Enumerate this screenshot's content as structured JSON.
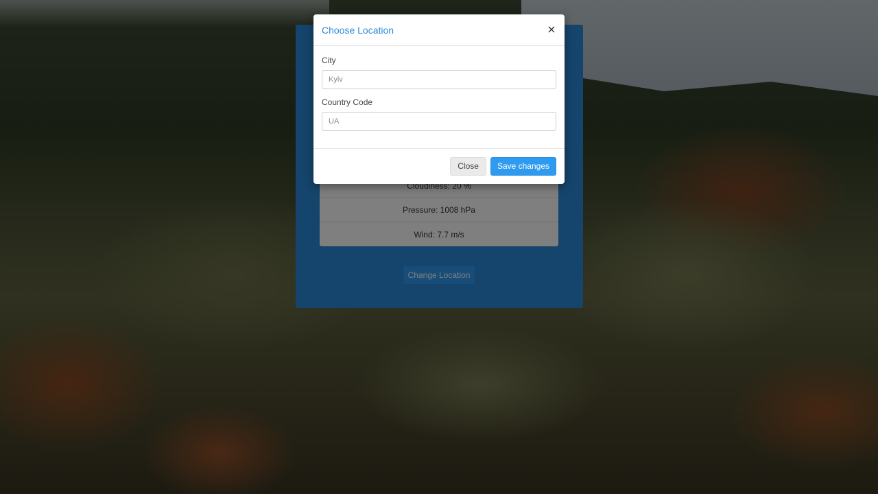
{
  "weather": {
    "rows": [
      {
        "label": "Cloudiness: 20 %"
      },
      {
        "label": "Pressure: 1008 hPa"
      },
      {
        "label": "Wind: 7.7 m/s"
      }
    ],
    "change_location_label": "Change Location"
  },
  "modal": {
    "title": "Choose Location",
    "close_glyph": "×",
    "city_label": "City",
    "city_placeholder": "Kyiv",
    "country_label": "Country Code",
    "country_placeholder": "UA",
    "close_button_label": "Close",
    "save_button_label": "Save changes"
  },
  "colors": {
    "accent": "#2a8ad8",
    "primary_button": "#2f9bf0"
  }
}
